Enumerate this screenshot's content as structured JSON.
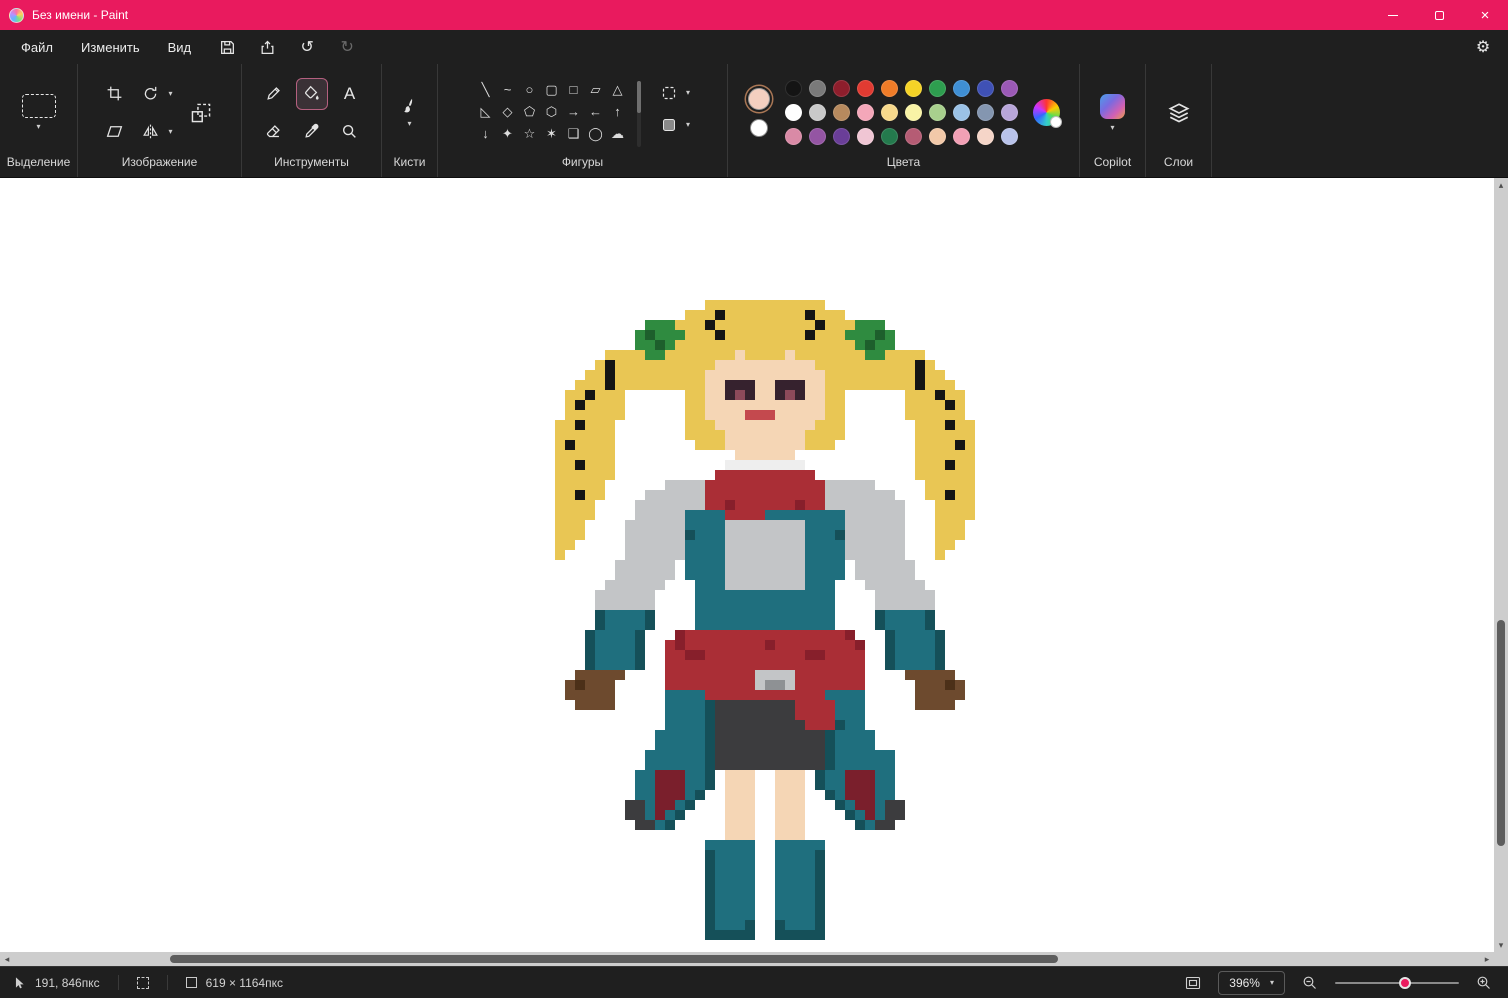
{
  "window": {
    "title": "Без имени - Paint"
  },
  "theme": {
    "accent": "#e91a5e"
  },
  "icons": {
    "chevron_down": "▾",
    "undo": "↺",
    "redo": "↻",
    "settings": "⚙",
    "close": "×",
    "text_tool": "А",
    "scroll_left": "◂",
    "scroll_right": "▸",
    "scroll_up": "▴",
    "scroll_down": "▾"
  },
  "menubar": {
    "items": [
      {
        "label": "Файл"
      },
      {
        "label": "Изменить"
      },
      {
        "label": "Вид"
      }
    ]
  },
  "ribbon": {
    "selection": {
      "label": "Выделение"
    },
    "image": {
      "label": "Изображение"
    },
    "tools": {
      "label": "Инструменты"
    },
    "brushes": {
      "label": "Кисти"
    },
    "shapes_label": "Фигуры",
    "colors_label": "Цвета",
    "copilot": {
      "label": "Copilot"
    },
    "layers": {
      "label": "Слои"
    }
  },
  "shapes": {
    "items": [
      {
        "name": "line",
        "glyph": "╲"
      },
      {
        "name": "curve",
        "glyph": "~"
      },
      {
        "name": "ellipse",
        "glyph": "○"
      },
      {
        "name": "rounded-rectangle",
        "glyph": "▢"
      },
      {
        "name": "rectangle",
        "glyph": "□"
      },
      {
        "name": "polygon",
        "glyph": "▱"
      },
      {
        "name": "triangle",
        "glyph": "△"
      },
      {
        "name": "right-triangle",
        "glyph": "◺"
      },
      {
        "name": "diamond",
        "glyph": "◇"
      },
      {
        "name": "pentagon",
        "glyph": "⬠"
      },
      {
        "name": "hexagon",
        "glyph": "⬡"
      },
      {
        "name": "right-arrow",
        "glyph": "→"
      },
      {
        "name": "left-arrow",
        "glyph": "←"
      },
      {
        "name": "up-arrow",
        "glyph": "↑"
      },
      {
        "name": "down-arrow",
        "glyph": "↓"
      },
      {
        "name": "four-point-star",
        "glyph": "✦"
      },
      {
        "name": "five-point-star",
        "glyph": "☆"
      },
      {
        "name": "six-point-star",
        "glyph": "✶"
      },
      {
        "name": "rounded-callout",
        "glyph": "❑"
      },
      {
        "name": "oval-callout",
        "glyph": "◯"
      },
      {
        "name": "cloud-callout",
        "glyph": "☁"
      }
    ]
  },
  "colors": {
    "primary": "#f3cfc0",
    "secondary": "#ffffff",
    "palette": [
      [
        "#141414",
        "#7a7a7a",
        "#8e1e2c",
        "#e13b32",
        "#f07c28",
        "#f5d327",
        "#2e9e4f",
        "#3f8fd4",
        "#3f51b5",
        "#9b59b6"
      ],
      [
        "#ffffff",
        "#c9c9c9",
        "#b78a5e",
        "#f4a7b9",
        "#f7d98c",
        "#f9f3a6",
        "#a8d08d",
        "#9bc2e6",
        "#8496b0",
        "#b8a6d9"
      ],
      [
        "#d98aa6",
        "#9455a3",
        "#6a3e98",
        "#f0c6d4",
        "#247a4d",
        "#b55c74",
        "#f2c9a9",
        "#f2a0b5",
        "#f5d5c8",
        "#b9c3ea"
      ]
    ]
  },
  "statusbar": {
    "cursor_position": "191, 846пкс",
    "canvas_size": "619 × 1164пкс",
    "zoom_level": "396%"
  },
  "pixel_art": {
    "cell": 10,
    "palette": {
      "K": "#141414",
      "Y": "#e9c654",
      "G": "#2f8b40",
      "g": "#1d5f2c",
      "S": "#f5d6b5",
      "E": "#36222e",
      "e": "#8c4a5a",
      "M": "#c4494e",
      "W": "#eeeeee",
      "R": "#aa2e36",
      "r": "#871f2b",
      "T": "#1f6f7e",
      "t": "#155059",
      "L": "#c3c5c7",
      "l": "#8e9194",
      "D": "#3c3c3e",
      "B": "#6d4a2e",
      "b": "#4c3018",
      "X": "#7a1f2c"
    },
    "rows": [
      "................YYYYYYYYYYYY................",
      "..............YYYKYYYYYYYYKYYY..............",
      "..........GGGYYYKYYYYYYYYYYKYYYGGG..........",
      ".........GgGGGYYYKYYYYYYYYKYYYGGGgG.........",
      ".........GGgGYYYYYYYYYYYYYYYYYYGgGG.........",
      "......YYYYGGYYYYYYYSYYYYSYYYYYYYGGYYYY......",
      ".....YKYYYYYYYYYYSSSSSSSSSSYYYYYYYYYYKY.....",
      "....YYKYYYYYYYYYSSSSSSSSSSSSYYYYYYYYYKYY....",
      "...YYYKYYYYYYYYYSSEEESSEEESSYYYYYYYYYKYYY...",
      "..YYKYYY......YYSSEeESSEeESSYY......YYYKYY..",
      "..YKYYYY......YYSSSSSSSSSSSSYY......YYYYKY..",
      "..YYYYYY......YYSSSSMMMSSSSSYY......YYYYYY..",
      ".YYKYYY.......YYYSSSSSSSSSSYYY.......YYYKYY.",
      ".YYYYYY.......YYYYSSSSSSSSYYYY.......YYYYYY.",
      ".YKYYYY........YYYSSSSSSSSYYY........YYYYKY.",
      ".YYYYYY............SSSSSS............YYYYYY.",
      ".YYKYYY...........WWWWWWWW...........YYYKYY.",
      ".YYYYYY..........RRRRRRRRRR..........YYYYYY.",
      ".YYYYY......LLLLRRRRRRRRRRRRLLLLL.....YYYYY.",
      ".YYKYY....LLLLLLRRRRRRRRRRRRLLLLLLL...YYKYY.",
      ".YYYY....LLLLLLLRRrRRRRRRrRRLLLLLLLL...YYYY.",
      ".YYYY....LLLLLTTTTRRRRTTTTTTTTLLLLLL...YYYY.",
      ".YYY....LLLLLLTTTTLLLLLLLLTTTTLLLLLL...YYY..",
      ".YYY....LLLLLLtTTTLLLLLLLLTTTtLLLLLL...YYY..",
      ".YY.....LLLLLLTTTTLLLLLLLLTTTTLLLLLL...YY...",
      ".Y......LLLLLLTTTTLLLLLLLLTTTTLLLLLL...Y....",
      ".......LLLLLL.TTTTLLLLLLLLTTTT.LLLLLL.......",
      ".......LLLLLL.TTTTLLLLLLLLTTTT.LLLLLL.......",
      "......LLLLLL...TTTLLLLLLLLTTT...LLLLLL......",
      ".....LLLLLL....TTTTTTTTTTTTTT....LLLLLL.....",
      ".....LLLLLL....TTTTTTTTTTTTTT....LLLLLL.....",
      ".....tTTTTt....TTTTTTTTTTTTTT....tTTTTt.....",
      ".....tTTTTt....TTTTTTTTTTTTTT....tTTTTt.....",
      "....tTTTTt...rRRRRRRRRRRRRRRRRr...tTTTTt....",
      "....tTTTTt..RrRRRRRRRRrRRRRRRRRr..tTTTTt....",
      "....tTTTTt..RRrrRRRRRRRRRRrrRRRR..tTTTTt....",
      "....tTTTTt..RRRRRRRRRRRRRRRRRRRR..tTTTTt....",
      "...BBBBB....RRRRRRRRRLLLLRRRRRRR....BBBBB...",
      "..BbBBB.....RRRRRRRRRLllLRRRRRRR.....BBBbB..",
      "..BBBBB.....TTTTRRRRRRRRRRRRTTTT.....BBBBB..",
      "...BBBB.....TTTTtDDDDDDDDRRRRTTT.....BBBB...",
      "............TTTTtDDDDDDDDRRRRTTT............",
      "............TTTTtDDDDDDDDDRRRtTT............",
      "...........TTTTTtDDDDDDDDDDDtTTTT...........",
      "...........TTTTTtDDDDDDDDDDDtTTTT...........",
      "..........TTTTTTtDDDDDDDDDDDtTTTTTT.........",
      "..........TTTTTTtDDDDDDDDDDDtTTTTTT.........",
      ".........TTXXXTTt.SSS..SSS.tTTXXXTT.........",
      ".........TTXXXTTt.SSS..SSS.tTTXXXTT.........",
      ".........TTXXXTt..SSS..SSS..tTXXXTT.........",
      "........DDTXXTt...SSS..SSS...tTXXTDD........",
      "........DDTXTt....SSS..SSS....tTXTDD........",
      ".........DDTt.....SSS..SSS.....tTDD.........",
      "..................SSS..SSS..................",
      "................TTTTT..TTTTT................",
      "................tTTTT..TTTTt................",
      "................tTTTT..TTTTt................",
      "................tTTTT..TTTTt................",
      "................tTTTT..TTTTt................",
      "................tTTTT..TTTTt................",
      "................tTTTT..TTTTt................",
      "................tTTTT..TTTTt................",
      "................tTTTt..tTTTt................",
      "................ttttt..ttttt................"
    ]
  }
}
